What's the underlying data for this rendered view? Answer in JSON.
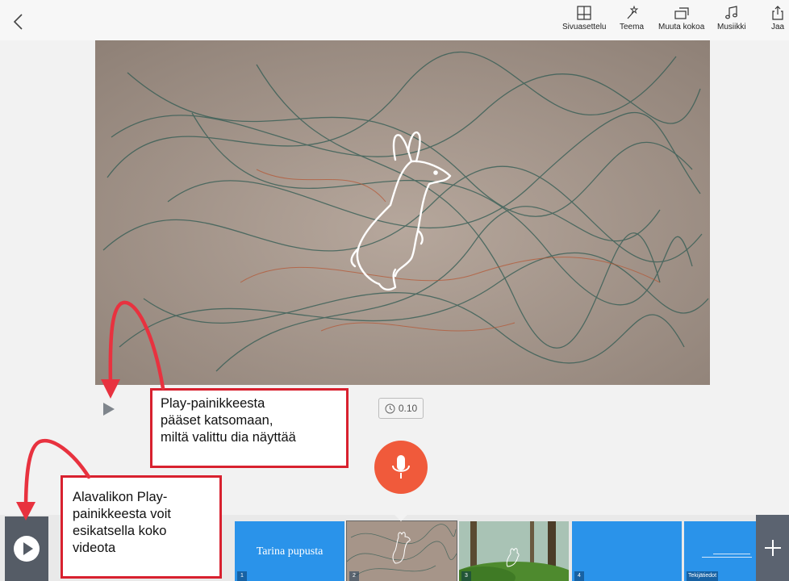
{
  "toolbar": {
    "back_icon": "chevron-left-icon",
    "items": [
      {
        "label": "Sivuasettelu",
        "icon": "layout-icon"
      },
      {
        "label": "Teema",
        "icon": "magic-wand-icon"
      },
      {
        "label": "Muuta kokoa",
        "icon": "resize-icon"
      },
      {
        "label": "Musiikki",
        "icon": "music-icon"
      },
      {
        "label": "Jaa",
        "icon": "share-icon"
      }
    ]
  },
  "editor": {
    "duration": "0.10",
    "timer_icon": "clock-icon",
    "record_icon": "microphone-icon"
  },
  "annotations": {
    "callout_top": "Play-painikkeesta\npääset katsomaan,\nmiltä valittu dia näyttää",
    "callout_bottom": "Alavalikon Play-\npainikkeesta voit\nesikatsella koko\nvideota"
  },
  "filmstrip": {
    "slides": [
      {
        "number": "1",
        "title": "Tarina pupusta"
      },
      {
        "number": "2"
      },
      {
        "number": "3"
      },
      {
        "number": "4"
      },
      {
        "number": "Tekijätiedot"
      }
    ],
    "selected_index": 1
  },
  "colors": {
    "accent_record": "#f05a3b",
    "slide_blue": "#2a93ea",
    "callout_border": "#d8212f",
    "arrow_red": "#e8323f",
    "play_panel": "#555c66"
  }
}
